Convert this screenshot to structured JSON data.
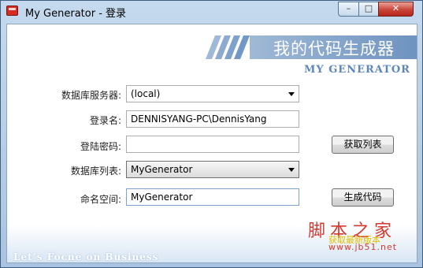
{
  "window": {
    "title": "My Generator - 登录",
    "controls": {
      "minimize": "–",
      "maximize": "□",
      "close": "✕"
    }
  },
  "banner": {
    "title": "我的代码生成器",
    "subtitle": "MY GENERATOR"
  },
  "form": {
    "server": {
      "label": "数据库服务器:",
      "value": "(local)"
    },
    "login": {
      "label": "登录名:",
      "value": "DENNISYANG-PC\\DennisYang"
    },
    "password": {
      "label": "登陆密码:",
      "value": ""
    },
    "get_list_button": "获取列表",
    "db_list": {
      "label": "数据库列表:",
      "value": "MyGenerator"
    },
    "namespace": {
      "label": "命名空间:",
      "value": "MyGenerator"
    },
    "generate_button": "生成代码"
  },
  "footer": {
    "slogan": "Let’s Focne on Business"
  },
  "watermark": {
    "title": "脚本之家",
    "subtitle": "获取最新版本",
    "url": "www.jb51.net"
  },
  "colors": {
    "title_bar": "#b4cce6",
    "banner": "#7fa2cc",
    "close_button": "#c9463a",
    "watermark": "#d23a30"
  },
  "icons": [
    "app-icon",
    "dropdown-arrow-icon"
  ]
}
